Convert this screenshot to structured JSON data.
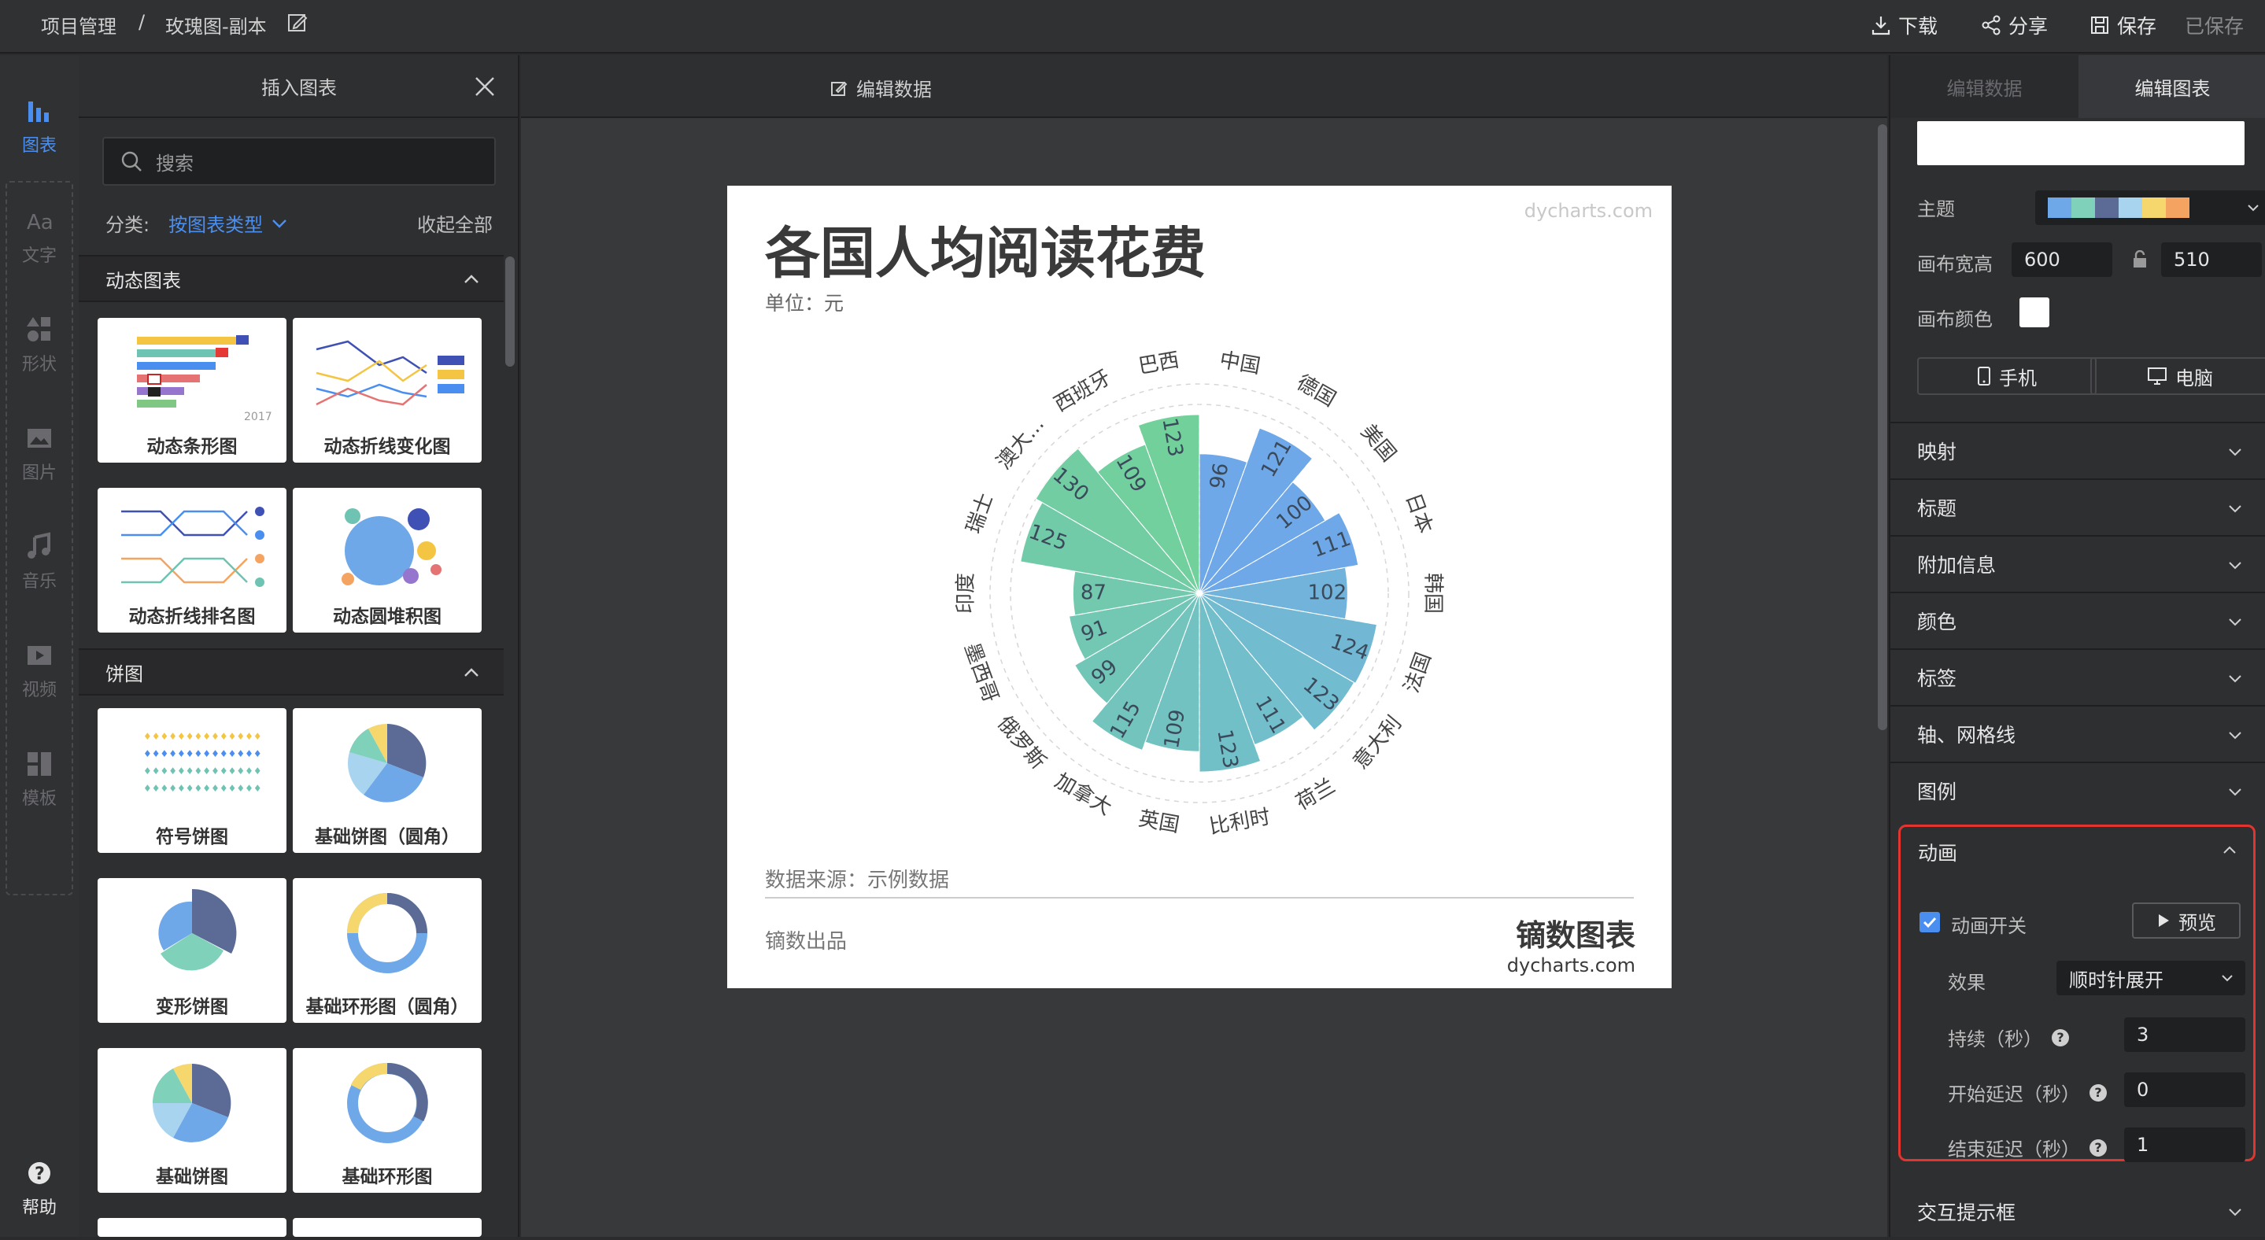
{
  "topbar": {
    "breadcrumb_root": "项目管理",
    "breadcrumb_sep": "/",
    "breadcrumb_current": "玫瑰图-副本",
    "download": "下载",
    "share": "分享",
    "save": "保存",
    "saved_status": "已保存"
  },
  "leftnav": {
    "items": [
      {
        "label": "图表",
        "icon": "chart-icon"
      },
      {
        "label": "文字",
        "icon": "text-icon"
      },
      {
        "label": "形状",
        "icon": "shape-icon"
      },
      {
        "label": "图片",
        "icon": "image-icon"
      },
      {
        "label": "音乐",
        "icon": "music-icon"
      },
      {
        "label": "视频",
        "icon": "video-icon"
      },
      {
        "label": "模板",
        "icon": "template-icon"
      }
    ],
    "help": "帮助"
  },
  "insert_panel": {
    "title": "插入图表",
    "search_placeholder": "搜索",
    "category_label": "分类:",
    "category_value": "按图表类型",
    "collapse_all": "收起全部",
    "sections": [
      {
        "title": "动态图表",
        "cards": [
          "动态条形图",
          "动态折线变化图",
          "动态折线排名图",
          "动态圆堆积图"
        ]
      },
      {
        "title": "饼图",
        "cards": [
          "符号饼图",
          "基础饼图（圆角）",
          "变形饼图",
          "基础环形图（圆角）",
          "基础饼图",
          "基础环形图"
        ]
      }
    ],
    "thumb_year": "2017"
  },
  "canvas": {
    "tab_label": "编辑数据"
  },
  "chart_page": {
    "title": "各国人均阅读花费",
    "unit": "单位：元",
    "watermark": "dycharts.com",
    "source": "数据来源：示例数据",
    "maker": "镝数出品",
    "brand_cn": "镝数图表",
    "brand_en": "dycharts.com"
  },
  "chart_data": {
    "type": "rose",
    "title": "各国人均阅读花费",
    "subtitle": "单位：元",
    "categories": [
      "中国",
      "德国",
      "美国",
      "日本",
      "韩国",
      "法国",
      "意大利",
      "荷兰",
      "比利时",
      "英国",
      "加拿大",
      "俄罗斯",
      "墨西哥",
      "印度",
      "瑞士",
      "澳大...",
      "西班牙",
      "巴西"
    ],
    "values": [
      96,
      121,
      100,
      111,
      102,
      124,
      123,
      111,
      123,
      109,
      115,
      99,
      91,
      87,
      125,
      130,
      109,
      123
    ],
    "colors": [
      "#6fa8e8",
      "#6fa8e8",
      "#6fa8e8",
      "#6fa8e8",
      "#72b3dc",
      "#72b8d4",
      "#72bcd0",
      "#72bfcb",
      "#72c0c7",
      "#72c2c2",
      "#72c4bd",
      "#72c6b8",
      "#72c8b2",
      "#72c9ad",
      "#72cba8",
      "#72cda3",
      "#72cf9e",
      "#72d19a"
    ],
    "legend": "none"
  },
  "right_panel": {
    "tab_data": "编辑数据",
    "tab_chart": "编辑图表",
    "theme_label": "主题",
    "theme_colors": [
      "#6fa8e8",
      "#7fd1b9",
      "#5b6b95",
      "#a8d4f0",
      "#f5d76e",
      "#f4a460"
    ],
    "canvas_width_label": "画布宽高",
    "canvas_width": "600",
    "canvas_height": "510",
    "canvas_color_label": "画布颜色",
    "mobile": "手机",
    "desktop": "电脑",
    "sections": [
      "映射",
      "标题",
      "附加信息",
      "颜色",
      "标签",
      "轴、网格线",
      "图例"
    ],
    "animation": {
      "title": "动画",
      "switch_label": "动画开关",
      "preview": "预览",
      "effect_label": "效果",
      "effect_value": "顺时针展开",
      "duration_label": "持续（秒）",
      "duration_value": "3",
      "start_delay_label": "开始延迟（秒）",
      "start_delay_value": "0",
      "end_delay_label": "结束延迟（秒）",
      "end_delay_value": "1"
    },
    "tooltip_section": "交互提示框"
  }
}
